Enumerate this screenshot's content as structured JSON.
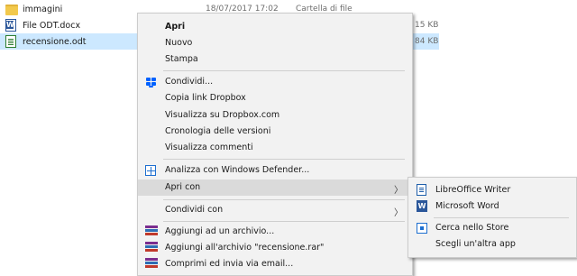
{
  "files": [
    {
      "name": "immagini",
      "icon": "folder-icon",
      "date": "18/07/2017 17:02",
      "type": "Cartella di file",
      "size": ""
    },
    {
      "name": "File ODT.docx",
      "icon": "docx-icon",
      "date": "",
      "type": "",
      "size": "15 KB"
    },
    {
      "name": "recensione.odt",
      "icon": "odt-icon",
      "date": "",
      "type": "",
      "size": "84 KB"
    }
  ],
  "context_menu": {
    "items": [
      {
        "label": "Apri",
        "bold": true
      },
      {
        "label": "Nuovo"
      },
      {
        "label": "Stampa"
      },
      {
        "label": "Condividi...",
        "icon": "dropbox-icon"
      },
      {
        "label": "Copia link Dropbox"
      },
      {
        "label": "Visualizza su Dropbox.com"
      },
      {
        "label": "Cronologia delle versioni"
      },
      {
        "label": "Visualizza commenti"
      },
      {
        "label": "Analizza con Windows Defender...",
        "icon": "defender-icon"
      },
      {
        "label": "Apri con",
        "submenu": true
      },
      {
        "label": "Condividi con",
        "submenu": true
      },
      {
        "label": "Aggiungi ad un archivio...",
        "icon": "winrar-icon"
      },
      {
        "label": "Aggiungi all'archivio \"recensione.rar\"",
        "icon": "winrar-icon"
      },
      {
        "label": "Comprimi ed invia via email...",
        "icon": "winrar-icon"
      }
    ],
    "arrow_glyph": "〉"
  },
  "open_with_submenu": {
    "items": [
      {
        "label": "LibreOffice Writer",
        "icon": "libreoffice-writer-icon"
      },
      {
        "label": "Microsoft Word",
        "icon": "word-icon"
      },
      {
        "label": "Cerca nello Store",
        "icon": "store-icon"
      },
      {
        "label": "Scegli un'altra app"
      }
    ],
    "word_glyph": "W"
  },
  "colors": {
    "selection": "#cce8ff",
    "menu_bg": "#f2f2f2",
    "hover": "#dadada",
    "dropbox": "#0061ff"
  }
}
